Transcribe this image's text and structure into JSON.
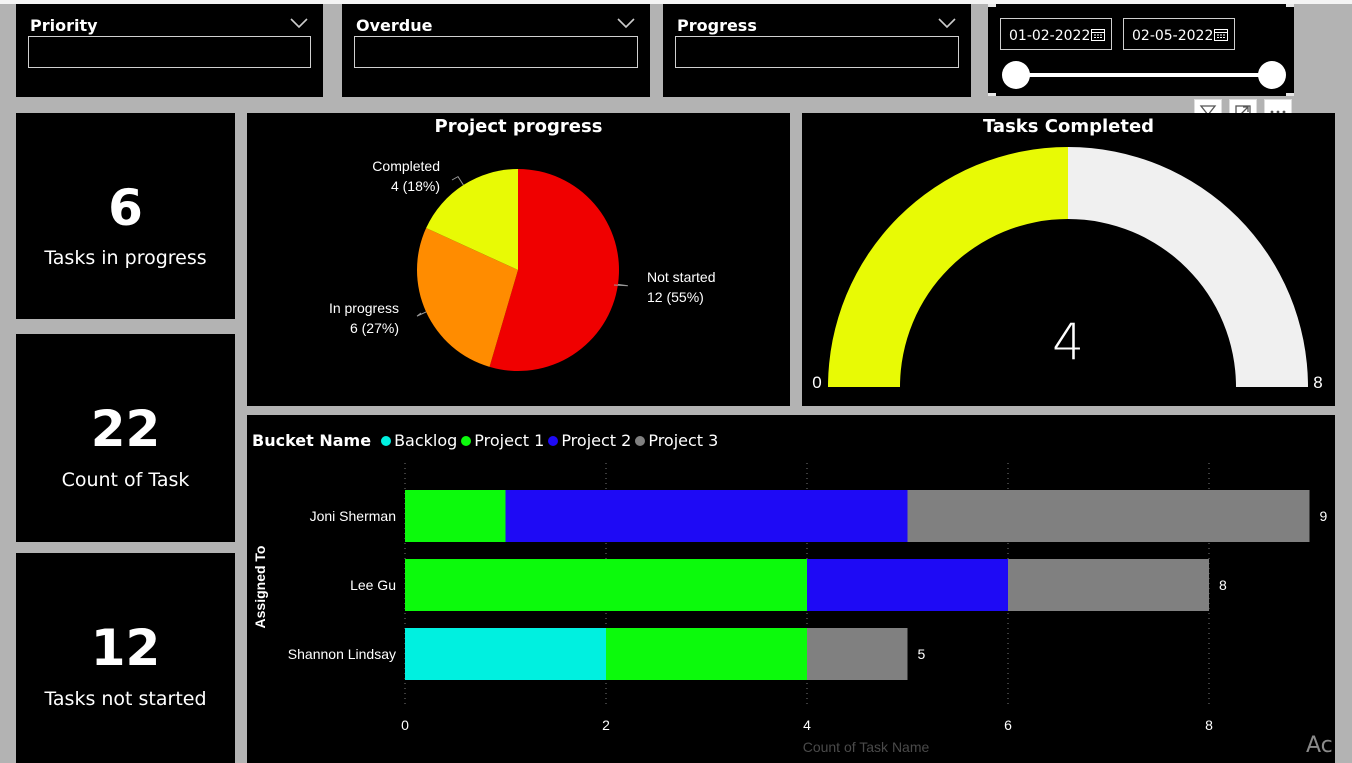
{
  "slicers": [
    {
      "title": "Priority",
      "value": ""
    },
    {
      "title": "Overdue",
      "value": ""
    },
    {
      "title": "Progress",
      "value": ""
    }
  ],
  "date_range": {
    "start": "01-02-2022",
    "end": "02-05-2022",
    "handle_start_fraction": 0,
    "handle_end_fraction": 1
  },
  "cards": [
    {
      "value": "6",
      "label": "Tasks in progress"
    },
    {
      "value": "22",
      "label": "Count of Task"
    },
    {
      "value": "12",
      "label": "Tasks not started"
    }
  ],
  "visual_toolbar": {
    "icons": [
      "filter-icon",
      "focus-mode-icon",
      "more-options-icon"
    ]
  },
  "chart_data": [
    {
      "type": "pie",
      "title": "Project progress",
      "slices": [
        {
          "name": "Not started",
          "value": 12,
          "percent_label": "12 (55%)",
          "color": "#f00000"
        },
        {
          "name": "In progress",
          "value": 6,
          "percent_label": "6 (27%)",
          "color": "#ff8c00"
        },
        {
          "name": "Completed",
          "value": 4,
          "percent_label": "4 (18%)",
          "color": "#e8fa05"
        }
      ]
    },
    {
      "type": "gauge",
      "title": "Tasks Completed",
      "value": 4,
      "value_label": "4",
      "min": 0,
      "max": 8,
      "min_label": "0",
      "max_label": "8",
      "fill_color": "#e8fa05",
      "track_color": "#f0f0f0"
    },
    {
      "type": "bar",
      "orientation": "horizontal",
      "stacked": true,
      "legend_title": "Bucket Name",
      "xlabel": "Count of Task Name",
      "ylabel": "Assigned To",
      "xlim": [
        0,
        9
      ],
      "xticks": [
        "0",
        "2",
        "4",
        "6",
        "8"
      ],
      "grid": true,
      "legend_position": "top-left",
      "categories": [
        "Joni Sherman",
        "Lee Gu",
        "Shannon Lindsay"
      ],
      "totals": [
        "9",
        "8",
        "5"
      ],
      "series": [
        {
          "name": "Backlog",
          "color": "#00f0e0",
          "values": [
            0,
            0,
            2
          ]
        },
        {
          "name": "Project 1",
          "color": "#0cfa0c",
          "values": [
            1,
            4,
            2
          ]
        },
        {
          "name": "Project 2",
          "color": "#1e0af5",
          "values": [
            4,
            2,
            0
          ]
        },
        {
          "name": "Project 3",
          "color": "#808080",
          "values": [
            4,
            2,
            1
          ]
        }
      ]
    }
  ],
  "watermark": "Ac"
}
